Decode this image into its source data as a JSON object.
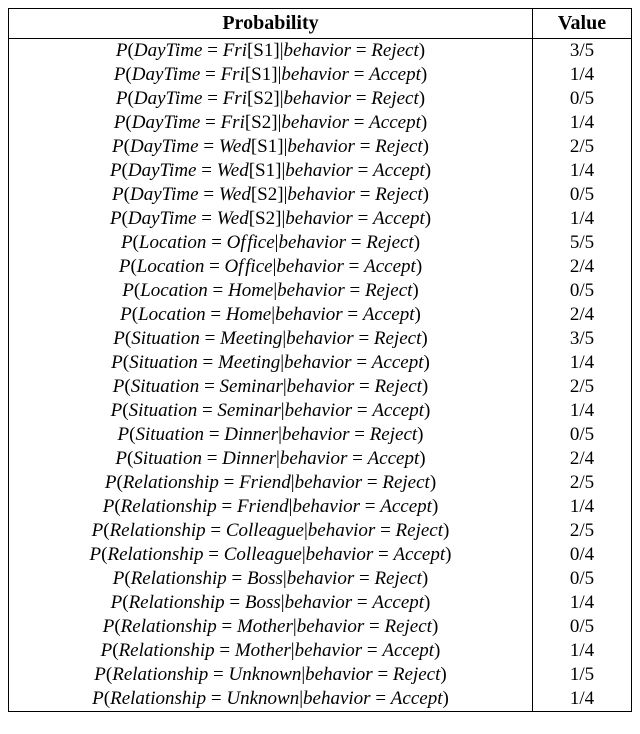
{
  "headers": {
    "col1": "Probability",
    "col2": "Value"
  },
  "rows": [
    {
      "attr": "DayTime",
      "aval": "Fri",
      "slot": "[S1]",
      "behavior": "Reject",
      "value": "3/5"
    },
    {
      "attr": "DayTime",
      "aval": "Fri",
      "slot": "[S1]",
      "behavior": "Accept",
      "value": "1/4"
    },
    {
      "attr": "DayTime",
      "aval": "Fri",
      "slot": "[S2]",
      "behavior": "Reject",
      "value": "0/5"
    },
    {
      "attr": "DayTime",
      "aval": "Fri",
      "slot": "[S2]",
      "behavior": "Accept",
      "value": "1/4"
    },
    {
      "attr": "DayTime",
      "aval": "Wed",
      "slot": "[S1]",
      "behavior": "Reject",
      "value": "2/5"
    },
    {
      "attr": "DayTime",
      "aval": "Wed",
      "slot": "[S1]",
      "behavior": "Accept",
      "value": "1/4"
    },
    {
      "attr": "DayTime",
      "aval": "Wed",
      "slot": "[S2]",
      "behavior": "Reject",
      "value": "0/5"
    },
    {
      "attr": "DayTime",
      "aval": "Wed",
      "slot": "[S2]",
      "behavior": "Accept",
      "value": "1/4"
    },
    {
      "attr": "Location",
      "aval": "Office",
      "slot": "",
      "behavior": "Reject",
      "value": "5/5"
    },
    {
      "attr": "Location",
      "aval": "Office",
      "slot": "",
      "behavior": "Accept",
      "value": "2/4"
    },
    {
      "attr": "Location",
      "aval": "Home",
      "slot": "",
      "behavior": "Reject",
      "value": "0/5"
    },
    {
      "attr": "Location",
      "aval": "Home",
      "slot": "",
      "behavior": "Accept",
      "value": "2/4"
    },
    {
      "attr": "Situation",
      "aval": "Meeting",
      "slot": "",
      "behavior": "Reject",
      "value": "3/5"
    },
    {
      "attr": "Situation",
      "aval": "Meeting",
      "slot": "",
      "behavior": "Accept",
      "value": "1/4"
    },
    {
      "attr": "Situation",
      "aval": "Seminar",
      "slot": "",
      "behavior": "Reject",
      "value": "2/5"
    },
    {
      "attr": "Situation",
      "aval": "Seminar",
      "slot": "",
      "behavior": "Accept",
      "value": "1/4"
    },
    {
      "attr": "Situation",
      "aval": "Dinner",
      "slot": "",
      "behavior": "Reject",
      "value": "0/5"
    },
    {
      "attr": "Situation",
      "aval": "Dinner",
      "slot": "",
      "behavior": "Accept",
      "value": "2/4"
    },
    {
      "attr": "Relationship",
      "aval": "Friend",
      "slot": "",
      "behavior": "Reject",
      "value": "2/5"
    },
    {
      "attr": "Relationship",
      "aval": "Friend",
      "slot": "",
      "behavior": "Accept",
      "value": "1/4"
    },
    {
      "attr": "Relationship",
      "aval": "Colleague",
      "slot": "",
      "behavior": "Reject",
      "value": "2/5"
    },
    {
      "attr": "Relationship",
      "aval": "Colleague",
      "slot": "",
      "behavior": "Accept",
      "value": "0/4"
    },
    {
      "attr": "Relationship",
      "aval": "Boss",
      "slot": "",
      "behavior": "Reject",
      "value": "0/5"
    },
    {
      "attr": "Relationship",
      "aval": "Boss",
      "slot": "",
      "behavior": "Accept",
      "value": "1/4"
    },
    {
      "attr": "Relationship",
      "aval": "Mother",
      "slot": "",
      "behavior": "Reject",
      "value": "0/5"
    },
    {
      "attr": "Relationship",
      "aval": "Mother",
      "slot": "",
      "behavior": "Accept",
      "value": "1/4"
    },
    {
      "attr": "Relationship",
      "aval": "Unknown",
      "slot": "",
      "behavior": "Reject",
      "value": "1/5"
    },
    {
      "attr": "Relationship",
      "aval": "Unknown",
      "slot": "",
      "behavior": "Accept",
      "value": "1/4"
    }
  ],
  "chart_data": {
    "type": "table",
    "title": "",
    "columns": [
      "Probability",
      "Value"
    ],
    "data": [
      [
        "P(DayTime = Fri[S1] | behavior = Reject)",
        "3/5"
      ],
      [
        "P(DayTime = Fri[S1] | behavior = Accept)",
        "1/4"
      ],
      [
        "P(DayTime = Fri[S2] | behavior = Reject)",
        "0/5"
      ],
      [
        "P(DayTime = Fri[S2] | behavior = Accept)",
        "1/4"
      ],
      [
        "P(DayTime = Wed[S1] | behavior = Reject)",
        "2/5"
      ],
      [
        "P(DayTime = Wed[S1] | behavior = Accept)",
        "1/4"
      ],
      [
        "P(DayTime = Wed[S2] | behavior = Reject)",
        "0/5"
      ],
      [
        "P(DayTime = Wed[S2] | behavior = Accept)",
        "1/4"
      ],
      [
        "P(Location = Office | behavior = Reject)",
        "5/5"
      ],
      [
        "P(Location = Office | behavior = Accept)",
        "2/4"
      ],
      [
        "P(Location = Home | behavior = Reject)",
        "0/5"
      ],
      [
        "P(Location = Home | behavior = Accept)",
        "2/4"
      ],
      [
        "P(Situation = Meeting | behavior = Reject)",
        "3/5"
      ],
      [
        "P(Situation = Meeting | behavior = Accept)",
        "1/4"
      ],
      [
        "P(Situation = Seminar | behavior = Reject)",
        "2/5"
      ],
      [
        "P(Situation = Seminar | behavior = Accept)",
        "1/4"
      ],
      [
        "P(Situation = Dinner | behavior = Reject)",
        "0/5"
      ],
      [
        "P(Situation = Dinner | behavior = Accept)",
        "2/4"
      ],
      [
        "P(Relationship = Friend | behavior = Reject)",
        "2/5"
      ],
      [
        "P(Relationship = Friend | behavior = Accept)",
        "1/4"
      ],
      [
        "P(Relationship = Colleague | behavior = Reject)",
        "2/5"
      ],
      [
        "P(Relationship = Colleague | behavior = Accept)",
        "0/4"
      ],
      [
        "P(Relationship = Boss | behavior = Reject)",
        "0/5"
      ],
      [
        "P(Relationship = Boss | behavior = Accept)",
        "1/4"
      ],
      [
        "P(Relationship = Mother | behavior = Reject)",
        "0/5"
      ],
      [
        "P(Relationship = Mother | behavior = Accept)",
        "1/4"
      ],
      [
        "P(Relationship = Unknown | behavior = Reject)",
        "1/5"
      ],
      [
        "P(Relationship = Unknown | behavior = Accept)",
        "1/4"
      ]
    ]
  }
}
